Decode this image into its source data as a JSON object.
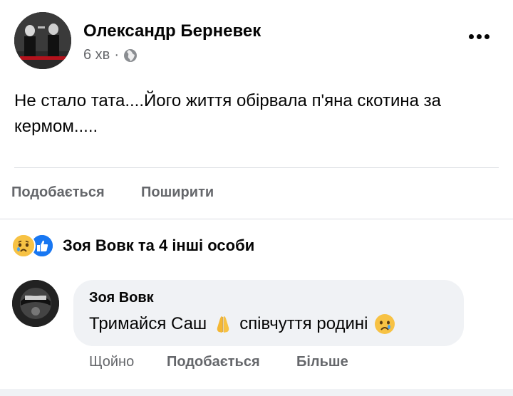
{
  "post": {
    "author": "Олександр Берневек",
    "time": "6 хв",
    "separator": "·",
    "privacy_icon": "globe-icon",
    "more_icon": "more-dots-icon",
    "text": "Не стало тата....Його життя обірвала п'яна скотина за кермом.....",
    "actions": {
      "like": "Подобається",
      "share": "Поширити"
    }
  },
  "reactions": {
    "icons": [
      "sad-reaction-icon",
      "like-reaction-icon"
    ],
    "summary": "Зоя Вовк та 4 інші особи"
  },
  "comment": {
    "author": "Зоя Вовк",
    "text_part1": "Тримайся Саш",
    "text_part2": "співчуття родині",
    "emoji1": "folded-hands-emoji",
    "emoji2": "crying-face-emoji",
    "time": "Щойно",
    "like": "Подобається",
    "more": "Більше"
  },
  "colors": {
    "text": "#050505",
    "secondary": "#65676b",
    "bubble": "#f0f2f5",
    "like_blue": "#1877f2"
  }
}
